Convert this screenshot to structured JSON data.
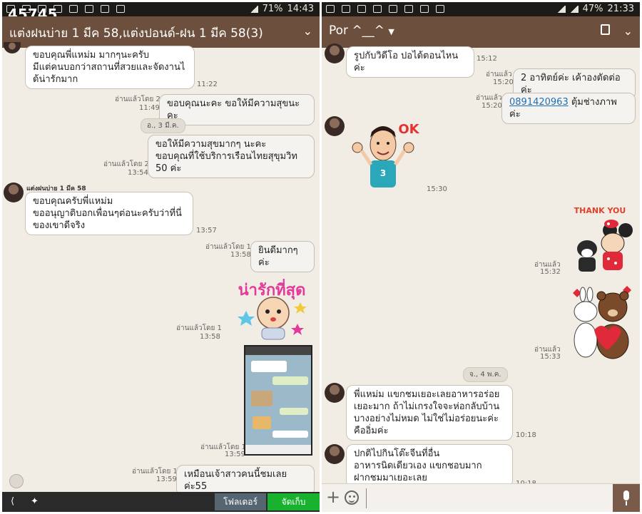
{
  "left": {
    "status": {
      "battery": "71%",
      "time": "14:43"
    },
    "overlay_number": "45745",
    "title": "แต่งฝนบ่าย 1 มีค 58,แต่งปอนด์-ฝน 1 มีค 58(3)",
    "messages": [
      {
        "text1": "ขอบคุณพี่แหม่ม มากๆนะครับ",
        "text2": "มีแต่คนบอกว่าสถานที่สวยและจัดงานไ",
        "text3": "ด้น่ารักมาก",
        "time": "11:22"
      },
      {
        "read": "อ่านแล้วโดย 2",
        "text": "ขอบคุณนะคะ ขอให้มีความสุขนะคะ",
        "time": "11:49"
      },
      {
        "date": "อ., 3 มี.ค."
      },
      {
        "read": "อ่านแล้วโดย 2",
        "text1": "ขอให้มีความสุขมากๆ นะคะ",
        "text2": "ขอบคุณที่ใช้บริการเรือนไทยสุขุมวิท",
        "text3": "50 ค่ะ",
        "time": "13:54"
      },
      {
        "sender": "แต่งฝนบ่าย 1 มีค 58",
        "text1": "ขอบคุณครับพี่แหม่ม",
        "text2": "ขออนุญาติบอกเพื่อนๆต่อนะครับว่าที่นี่",
        "text3": "ของเขาดีจริง",
        "time": "13:57"
      },
      {
        "read": "อ่านแล้วโดย 1",
        "text": "ยินดีมากๆ ค่ะ",
        "time": "13:58"
      },
      {
        "read": "อ่านแล้วโดย 1",
        "time": "13:58",
        "sticker_text": "น่ารักที่สุด"
      },
      {
        "read": "อ่านแล้วโดย 1",
        "time": "13:59"
      },
      {
        "read": "อ่านแล้วโดย 1",
        "text": "เหมือนเจ้าสาวคนนี้ชมเลยค่ะ55",
        "time": "13:59"
      }
    ],
    "buttons": {
      "follow": "โฟลเดอร์",
      "save": "จัดเก็บ"
    }
  },
  "right": {
    "status": {
      "battery": "47%",
      "time": "21:33"
    },
    "title": "Por ^__^",
    "messages": [
      {
        "text": "รูปกับวิดีโอ ปอได้ตอนไหนค่ะ",
        "time": "15:12"
      },
      {
        "read": "อ่านแล้ว",
        "text": "2 อาทิตย์ค่ะ เค้าองตัดต่อค่ะ",
        "time": "15:20"
      },
      {
        "read": "อ่านแล้ว",
        "phone": "0891420963",
        "text": " ตุ้มช่างภาพค่ะ",
        "time": "15:20"
      },
      {
        "time": "15:30",
        "sticker_text": "OK"
      },
      {
        "read": "อ่านแล้ว",
        "time": "15:32",
        "sticker_text": "THANK YOU"
      },
      {
        "read": "อ่านแล้ว",
        "time": "15:33"
      },
      {
        "date": "จ., 4 พ.ค."
      },
      {
        "text1": "พี่แหม่ม แขกชมเยอะเลยอาหารอร่อย",
        "text2": "เยอะมาก ถ้าไม่เกรงใจจะห่อกลับบ้าน",
        "text3": "บางอย่างไม่หมด ไม่ใช่ไม่อร่อยนะค่ะ",
        "text4": "คืออิ่มค่ะ",
        "time": "10:18"
      },
      {
        "text1": "ปกติไปกินโต๊ะจีนที่อื่น",
        "text2": "อาหารนิดเดียวเอง แขกชอบมาก",
        "text3": "ฝากชมมาเยอะเลย",
        "time": "10:18"
      }
    ]
  },
  "colors": {
    "header": "#6d4f3d",
    "background": "#f1ede4",
    "save_button": "#18b22e",
    "folder_button": "#566572"
  }
}
